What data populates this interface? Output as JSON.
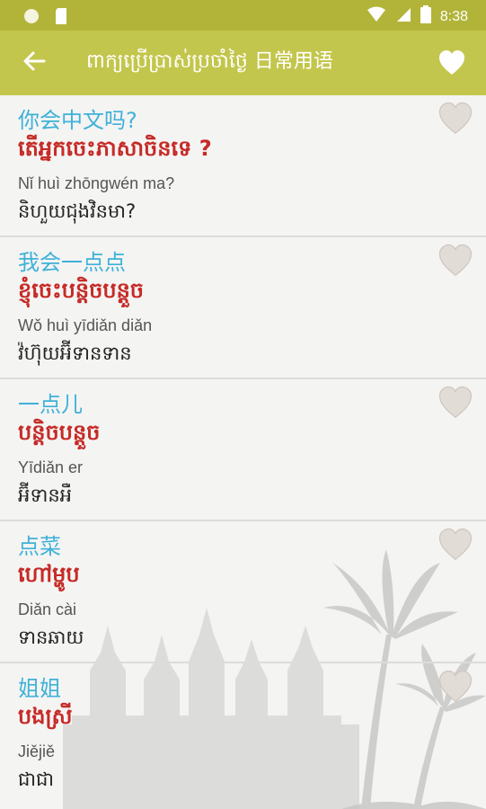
{
  "status_bar": {
    "time": "8:38"
  },
  "app_bar": {
    "title": "ពាក្យប្រើប្រាស់ប្រចាំថ្ងៃ 日常用语"
  },
  "phrases": [
    {
      "chinese": "你会中文吗?",
      "khmer": "តើអ្នកចេះភាសាចិនទេ ?",
      "pinyin": "Nǐ huì zhōngwén ma?",
      "phonetic": "និហួយជុងវិនមា?"
    },
    {
      "chinese": "我会一点点",
      "khmer": "ខ្ញុំចេះបន្តិចបន្តួច",
      "pinyin": "Wǒ huì yīdiǎn diǎn",
      "phonetic": "វ៉ហ៊ុយអ៊ីទានទាន"
    },
    {
      "chinese": "一点儿",
      "khmer": "បន្តិចបន្តួច",
      "pinyin": "Yīdiǎn er",
      "phonetic": "អ៊ីទានអឺ"
    },
    {
      "chinese": "点菜",
      "khmer": "ហៅម្ហូប",
      "pinyin": "Diǎn cài",
      "phonetic": "ទានឆាយ"
    },
    {
      "chinese": "姐姐",
      "khmer": "បងស្រី",
      "pinyin": "Jiějiě",
      "phonetic": "ជាជា"
    }
  ],
  "colors": {
    "status_bar": "#b2b43a",
    "app_bar": "#c3c64c",
    "chinese_text": "#3fb1d8",
    "khmer_text": "#c62b27"
  },
  "icons": {
    "back": "arrow-left-icon",
    "favorite": "heart-icon"
  }
}
